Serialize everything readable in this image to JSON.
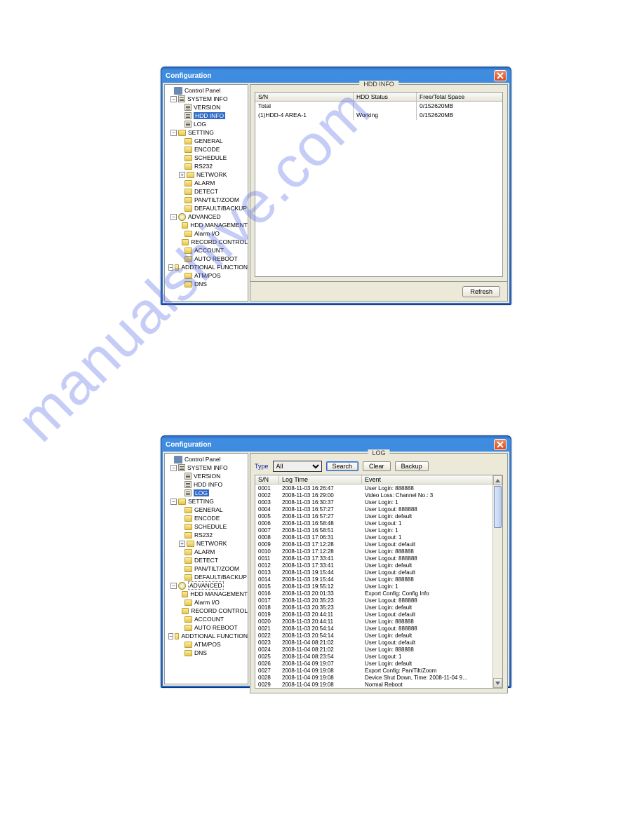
{
  "window_title": "Configuration",
  "watermark_text": "manualshive.com",
  "tree": {
    "root": "Control Panel",
    "groups": [
      {
        "label": "SYSTEM INFO",
        "items": [
          "VERSION",
          "HDD INFO",
          "LOG"
        ]
      },
      {
        "label": "SETTING",
        "items": [
          "GENERAL",
          "ENCODE",
          "SCHEDULE",
          "RS232",
          "NETWORK",
          "ALARM",
          "DETECT",
          "PAN/TILT/ZOOM",
          "DEFAULT/BACKUP"
        ]
      },
      {
        "label": "ADVANCED",
        "items": [
          "HDD MANAGEMENT",
          "Alarm I/O",
          "RECORD CONTROL",
          "ACCOUNT",
          "AUTO REBOOT"
        ]
      },
      {
        "label": "ADDTIONAL FUNCTION",
        "items": [
          "ATM/POS",
          "DNS"
        ]
      }
    ]
  },
  "hdd": {
    "panel_title": "HDD INFO",
    "cols": {
      "sn": "S/N",
      "status": "HDD Status",
      "space": "Free/Total Space"
    },
    "rows": [
      {
        "sn": "Total",
        "status": "",
        "space": "0/152620MB"
      },
      {
        "sn": "(1)HDD-4 AREA-1",
        "status": "Working",
        "space": "0/152620MB"
      }
    ],
    "refresh": "Refresh"
  },
  "log": {
    "panel_title": "LOG",
    "type_label": "Type",
    "type_value": "All",
    "search": "Search",
    "clear": "Clear",
    "backup": "Backup",
    "cols": {
      "sn": "S/N",
      "time": "Log Time",
      "event": "Event"
    },
    "rows": [
      {
        "sn": "0001",
        "time": "2008-11-03 16:26:47",
        "event": "User Login: 888888"
      },
      {
        "sn": "0002",
        "time": "2008-11-03 16:29:00",
        "event": "Video Loss: Channel No.: 3"
      },
      {
        "sn": "0003",
        "time": "2008-11-03 16:30:37",
        "event": "User Login: 1"
      },
      {
        "sn": "0004",
        "time": "2008-11-03 16:57:27",
        "event": "User Logout: 888888"
      },
      {
        "sn": "0005",
        "time": "2008-11-03 16:57:27",
        "event": "User Login: default"
      },
      {
        "sn": "0006",
        "time": "2008-11-03 16:58:48",
        "event": "User Logout: 1"
      },
      {
        "sn": "0007",
        "time": "2008-11-03 16:58:51",
        "event": "User Login: 1"
      },
      {
        "sn": "0008",
        "time": "2008-11-03 17:06:31",
        "event": "User Logout: 1"
      },
      {
        "sn": "0009",
        "time": "2008-11-03 17:12:28",
        "event": "User Logout: default"
      },
      {
        "sn": "0010",
        "time": "2008-11-03 17:12:28",
        "event": "User Login: 888888"
      },
      {
        "sn": "0011",
        "time": "2008-11-03 17:33:41",
        "event": "User Logout: 888888"
      },
      {
        "sn": "0012",
        "time": "2008-11-03 17:33:41",
        "event": "User Login: default"
      },
      {
        "sn": "0013",
        "time": "2008-11-03 19:15:44",
        "event": "User Logout: default"
      },
      {
        "sn": "0014",
        "time": "2008-11-03 19:15:44",
        "event": "User Login: 888888"
      },
      {
        "sn": "0015",
        "time": "2008-11-03 19:55:12",
        "event": "User Login: 1"
      },
      {
        "sn": "0016",
        "time": "2008-11-03 20:01:33",
        "event": "Export Config: Config Info"
      },
      {
        "sn": "0017",
        "time": "2008-11-03 20:35:23",
        "event": "User Logout: 888888"
      },
      {
        "sn": "0018",
        "time": "2008-11-03 20:35:23",
        "event": "User Login: default"
      },
      {
        "sn": "0019",
        "time": "2008-11-03 20:44:11",
        "event": "User Logout: default"
      },
      {
        "sn": "0020",
        "time": "2008-11-03 20:44:11",
        "event": "User Login: 888888"
      },
      {
        "sn": "0021",
        "time": "2008-11-03 20:54:14",
        "event": "User Logout: 888888"
      },
      {
        "sn": "0022",
        "time": "2008-11-03 20:54:14",
        "event": "User Login: default"
      },
      {
        "sn": "0023",
        "time": "2008-11-04 08:21:02",
        "event": "User Logout: default"
      },
      {
        "sn": "0024",
        "time": "2008-11-04 08:21:02",
        "event": "User Login: 888888"
      },
      {
        "sn": "0025",
        "time": "2008-11-04 08:23:54",
        "event": "User Logout: 1"
      },
      {
        "sn": "0026",
        "time": "2008-11-04 09:19:07",
        "event": "User Login: default"
      },
      {
        "sn": "0027",
        "time": "2008-11-04 09:19:08",
        "event": "Export Config: Pan/Tilt/Zoom"
      },
      {
        "sn": "0028",
        "time": "2008-11-04 09:19:08",
        "event": "Device Shut Down, Time: 2008-11-04 9…"
      },
      {
        "sn": "0029",
        "time": "2008-11-04 09:19:08",
        "event": "Normal Reboot"
      }
    ]
  }
}
